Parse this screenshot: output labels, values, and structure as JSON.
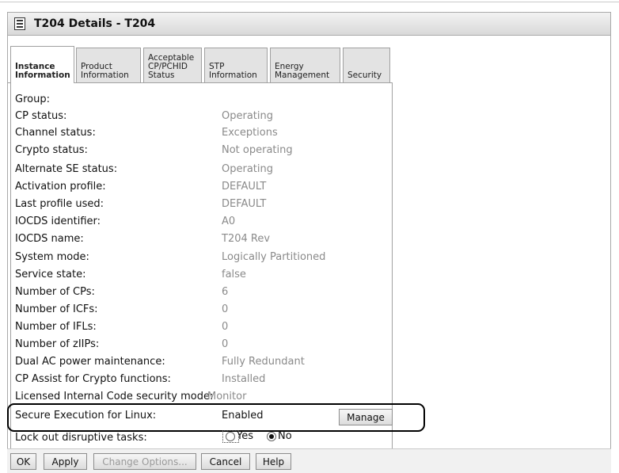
{
  "window": {
    "title": "T204 Details - T204"
  },
  "tabs": [
    {
      "label": "Instance\nInformation",
      "active": true
    },
    {
      "label": "Product\nInformation",
      "active": false
    },
    {
      "label": "Acceptable\nCP/PCHID\nStatus",
      "active": false
    },
    {
      "label": "STP\nInformation",
      "active": false
    },
    {
      "label": "Energy\nManagement",
      "active": false
    },
    {
      "label": "Security",
      "active": false
    }
  ],
  "fields": [
    {
      "label": "Group:",
      "value": ""
    },
    {
      "label": "CP status:",
      "value": "Operating"
    },
    {
      "label": "Channel status:",
      "value": "Exceptions"
    },
    {
      "label": "Crypto status:",
      "value": "Not operating"
    },
    {
      "label": "Alternate SE status:",
      "value": "Operating"
    },
    {
      "label": "Activation profile:",
      "value": "DEFAULT"
    },
    {
      "label": "Last profile used:",
      "value": "DEFAULT"
    },
    {
      "label": "IOCDS identifier:",
      "value": "A0"
    },
    {
      "label": "IOCDS name:",
      "value": "T204 Rev"
    },
    {
      "label": "System mode:",
      "value": "Logically Partitioned"
    },
    {
      "label": "Service state:",
      "value": "false"
    },
    {
      "label": "Number of CPs:",
      "value": "6"
    },
    {
      "label": "Number of ICFs:",
      "value": "0"
    },
    {
      "label": "Number of IFLs:",
      "value": "0"
    },
    {
      "label": "Number of zIIPs:",
      "value": "0"
    },
    {
      "label": "Dual AC power maintenance:",
      "value": "Fully Redundant"
    },
    {
      "label": "CP Assist for Crypto functions:",
      "value": "Installed"
    },
    {
      "label": "Licensed Internal Code security mode:",
      "value": "Monitor"
    }
  ],
  "secure_execution": {
    "label": "Secure Execution for Linux:",
    "value": "Enabled",
    "button": "Manage"
  },
  "lockout": {
    "label": "Lock out disruptive tasks:",
    "yes": "Yes",
    "no": "No",
    "selected": "No"
  },
  "buttons": {
    "ok": "OK",
    "apply": "Apply",
    "change_options": "Change Options...",
    "cancel": "Cancel",
    "help": "Help"
  }
}
